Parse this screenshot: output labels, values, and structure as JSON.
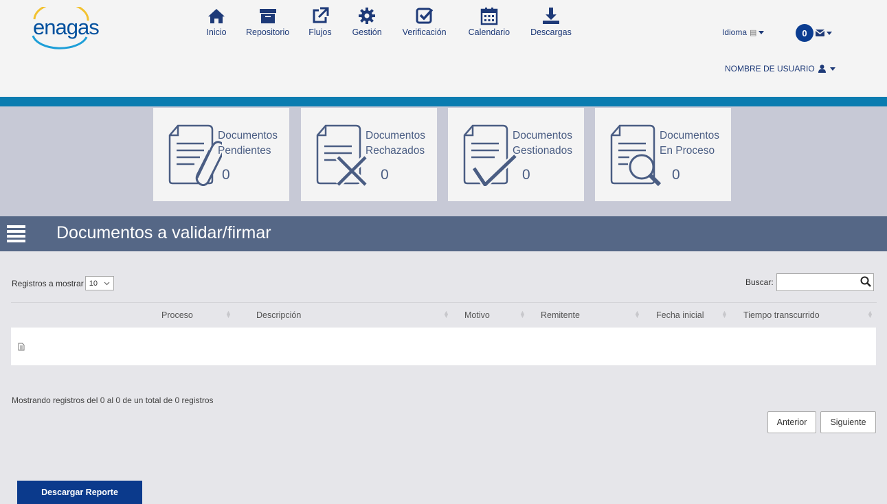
{
  "brand": {
    "logo_text": "enagas"
  },
  "nav": [
    {
      "label": "Inicio",
      "icon": "home-icon"
    },
    {
      "label": "Repositorio",
      "icon": "archive-icon"
    },
    {
      "label": "Flujos",
      "icon": "external-link-icon"
    },
    {
      "label": "Gestión",
      "icon": "gear-icon"
    },
    {
      "label": "Verificación",
      "icon": "check-square-icon"
    },
    {
      "label": "Calendario",
      "icon": "calendar-icon"
    },
    {
      "label": "Descargas",
      "icon": "download-icon"
    }
  ],
  "header": {
    "language_label": "Idioma",
    "messages_count": "0",
    "user_name": "NOMBRE DE USUARIO"
  },
  "cards": [
    {
      "line1": "Documentos",
      "line2": "Pendientes",
      "count": "0",
      "icon": "document-clip-icon"
    },
    {
      "line1": "Documentos",
      "line2": "Rechazados",
      "count": "0",
      "icon": "document-rejected-icon"
    },
    {
      "line1": "Documentos",
      "line2": "Gestionados",
      "count": "0",
      "icon": "document-check-icon"
    },
    {
      "line1": "Documentos",
      "line2": "En Proceso",
      "count": "0",
      "icon": "document-search-icon"
    }
  ],
  "section": {
    "title": "Documentos a validar/firmar"
  },
  "table": {
    "show_label": "Registros a mostrar",
    "page_size": "10",
    "search_label": "Buscar:",
    "search_value": "",
    "columns": [
      "Proceso",
      "Descripción",
      "Motivo",
      "Remitente",
      "Fecha inicial",
      "Tiempo transcurrido"
    ],
    "info": "Mostrando registros del  0 al  0  de un total de  0  registros",
    "prev_label": "Anterior",
    "next_label": "Siguiente"
  },
  "report_button": "Descargar Reporte",
  "colors": {
    "primary": "#0b3a8c",
    "accent_bar": "#0a7cb0",
    "section_bg": "#556786",
    "band_bg": "#c7c9d6"
  }
}
